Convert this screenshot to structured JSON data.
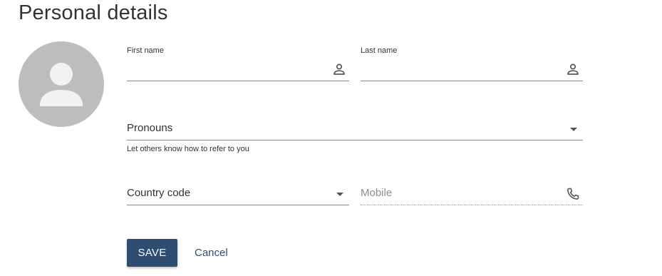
{
  "header": {
    "title": "Personal details"
  },
  "avatar": {
    "icon": "person-icon",
    "background_color": "#bdbdbd"
  },
  "form": {
    "first_name": {
      "label": "First name",
      "value": "",
      "icon": "person-outline-icon"
    },
    "last_name": {
      "label": "Last name",
      "value": "",
      "icon": "person-outline-icon"
    },
    "pronouns": {
      "value": "Pronouns",
      "helper": "Let others know how to refer to you",
      "icon": "chevron-down-icon"
    },
    "country_code": {
      "value": "Country code",
      "icon": "chevron-down-icon"
    },
    "mobile": {
      "placeholder": "Mobile",
      "icon": "phone-icon"
    }
  },
  "actions": {
    "save_label": "SAVE",
    "cancel_label": "Cancel"
  },
  "colors": {
    "primary": "#2f4d70",
    "text": "#333333",
    "placeholder": "#8e8e8e"
  }
}
